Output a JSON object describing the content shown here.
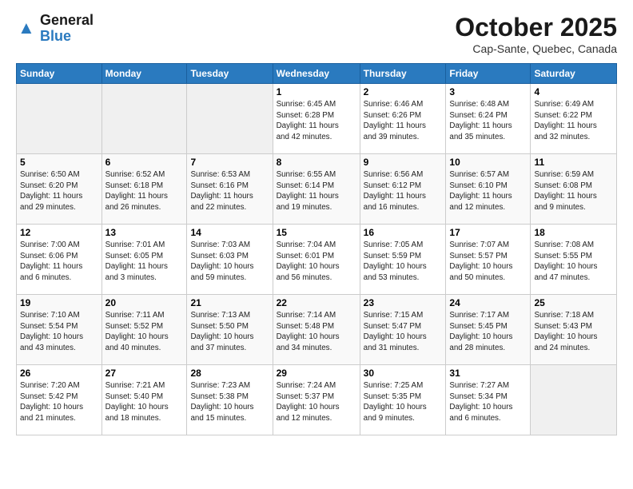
{
  "header": {
    "logo_general": "General",
    "logo_blue": "Blue",
    "month_title": "October 2025",
    "subtitle": "Cap-Sante, Quebec, Canada"
  },
  "days_of_week": [
    "Sunday",
    "Monday",
    "Tuesday",
    "Wednesday",
    "Thursday",
    "Friday",
    "Saturday"
  ],
  "weeks": [
    [
      {
        "day": "",
        "info": ""
      },
      {
        "day": "",
        "info": ""
      },
      {
        "day": "",
        "info": ""
      },
      {
        "day": "1",
        "info": "Sunrise: 6:45 AM\nSunset: 6:28 PM\nDaylight: 11 hours\nand 42 minutes."
      },
      {
        "day": "2",
        "info": "Sunrise: 6:46 AM\nSunset: 6:26 PM\nDaylight: 11 hours\nand 39 minutes."
      },
      {
        "day": "3",
        "info": "Sunrise: 6:48 AM\nSunset: 6:24 PM\nDaylight: 11 hours\nand 35 minutes."
      },
      {
        "day": "4",
        "info": "Sunrise: 6:49 AM\nSunset: 6:22 PM\nDaylight: 11 hours\nand 32 minutes."
      }
    ],
    [
      {
        "day": "5",
        "info": "Sunrise: 6:50 AM\nSunset: 6:20 PM\nDaylight: 11 hours\nand 29 minutes."
      },
      {
        "day": "6",
        "info": "Sunrise: 6:52 AM\nSunset: 6:18 PM\nDaylight: 11 hours\nand 26 minutes."
      },
      {
        "day": "7",
        "info": "Sunrise: 6:53 AM\nSunset: 6:16 PM\nDaylight: 11 hours\nand 22 minutes."
      },
      {
        "day": "8",
        "info": "Sunrise: 6:55 AM\nSunset: 6:14 PM\nDaylight: 11 hours\nand 19 minutes."
      },
      {
        "day": "9",
        "info": "Sunrise: 6:56 AM\nSunset: 6:12 PM\nDaylight: 11 hours\nand 16 minutes."
      },
      {
        "day": "10",
        "info": "Sunrise: 6:57 AM\nSunset: 6:10 PM\nDaylight: 11 hours\nand 12 minutes."
      },
      {
        "day": "11",
        "info": "Sunrise: 6:59 AM\nSunset: 6:08 PM\nDaylight: 11 hours\nand 9 minutes."
      }
    ],
    [
      {
        "day": "12",
        "info": "Sunrise: 7:00 AM\nSunset: 6:06 PM\nDaylight: 11 hours\nand 6 minutes."
      },
      {
        "day": "13",
        "info": "Sunrise: 7:01 AM\nSunset: 6:05 PM\nDaylight: 11 hours\nand 3 minutes."
      },
      {
        "day": "14",
        "info": "Sunrise: 7:03 AM\nSunset: 6:03 PM\nDaylight: 10 hours\nand 59 minutes."
      },
      {
        "day": "15",
        "info": "Sunrise: 7:04 AM\nSunset: 6:01 PM\nDaylight: 10 hours\nand 56 minutes."
      },
      {
        "day": "16",
        "info": "Sunrise: 7:05 AM\nSunset: 5:59 PM\nDaylight: 10 hours\nand 53 minutes."
      },
      {
        "day": "17",
        "info": "Sunrise: 7:07 AM\nSunset: 5:57 PM\nDaylight: 10 hours\nand 50 minutes."
      },
      {
        "day": "18",
        "info": "Sunrise: 7:08 AM\nSunset: 5:55 PM\nDaylight: 10 hours\nand 47 minutes."
      }
    ],
    [
      {
        "day": "19",
        "info": "Sunrise: 7:10 AM\nSunset: 5:54 PM\nDaylight: 10 hours\nand 43 minutes."
      },
      {
        "day": "20",
        "info": "Sunrise: 7:11 AM\nSunset: 5:52 PM\nDaylight: 10 hours\nand 40 minutes."
      },
      {
        "day": "21",
        "info": "Sunrise: 7:13 AM\nSunset: 5:50 PM\nDaylight: 10 hours\nand 37 minutes."
      },
      {
        "day": "22",
        "info": "Sunrise: 7:14 AM\nSunset: 5:48 PM\nDaylight: 10 hours\nand 34 minutes."
      },
      {
        "day": "23",
        "info": "Sunrise: 7:15 AM\nSunset: 5:47 PM\nDaylight: 10 hours\nand 31 minutes."
      },
      {
        "day": "24",
        "info": "Sunrise: 7:17 AM\nSunset: 5:45 PM\nDaylight: 10 hours\nand 28 minutes."
      },
      {
        "day": "25",
        "info": "Sunrise: 7:18 AM\nSunset: 5:43 PM\nDaylight: 10 hours\nand 24 minutes."
      }
    ],
    [
      {
        "day": "26",
        "info": "Sunrise: 7:20 AM\nSunset: 5:42 PM\nDaylight: 10 hours\nand 21 minutes."
      },
      {
        "day": "27",
        "info": "Sunrise: 7:21 AM\nSunset: 5:40 PM\nDaylight: 10 hours\nand 18 minutes."
      },
      {
        "day": "28",
        "info": "Sunrise: 7:23 AM\nSunset: 5:38 PM\nDaylight: 10 hours\nand 15 minutes."
      },
      {
        "day": "29",
        "info": "Sunrise: 7:24 AM\nSunset: 5:37 PM\nDaylight: 10 hours\nand 12 minutes."
      },
      {
        "day": "30",
        "info": "Sunrise: 7:25 AM\nSunset: 5:35 PM\nDaylight: 10 hours\nand 9 minutes."
      },
      {
        "day": "31",
        "info": "Sunrise: 7:27 AM\nSunset: 5:34 PM\nDaylight: 10 hours\nand 6 minutes."
      },
      {
        "day": "",
        "info": ""
      }
    ]
  ]
}
